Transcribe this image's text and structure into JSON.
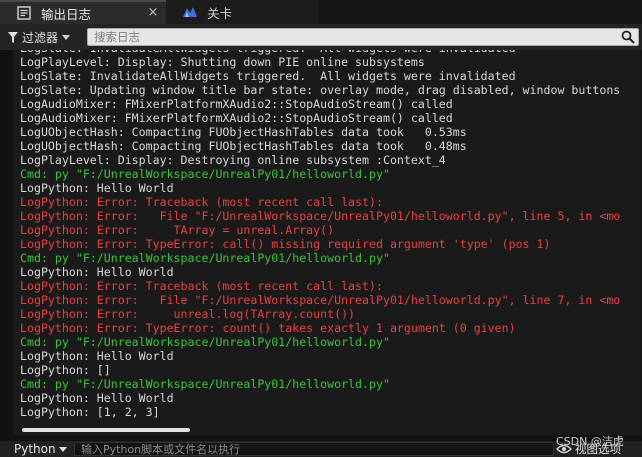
{
  "tabs": [
    {
      "label": "输出日志",
      "icon": "output-log-icon",
      "active": true
    },
    {
      "label": "关卡",
      "icon": "unreal-level-icon",
      "active": false
    }
  ],
  "tab_close": "×",
  "filter": {
    "label": "过滤器",
    "search_placeholder": "搜索日志"
  },
  "log_lines": [
    {
      "text": "LogSlate: InvalidateAllWidgets triggered.  All widgets were invalidated",
      "kind": "normal"
    },
    {
      "text": "LogPlayLevel: Display: Shutting down PIE online subsystems",
      "kind": "normal"
    },
    {
      "text": "LogSlate: InvalidateAllWidgets triggered.  All widgets were invalidated",
      "kind": "normal"
    },
    {
      "text": "LogSlate: Updating window title bar state: overlay mode, drag disabled, window buttons",
      "kind": "normal"
    },
    {
      "text": "LogAudioMixer: FMixerPlatformXAudio2::StopAudioStream() called",
      "kind": "normal"
    },
    {
      "text": "LogAudioMixer: FMixerPlatformXAudio2::StopAudioStream() called",
      "kind": "normal"
    },
    {
      "text": "LogUObjectHash: Compacting FUObjectHashTables data took   0.53ms",
      "kind": "normal"
    },
    {
      "text": "LogUObjectHash: Compacting FUObjectHashTables data took   0.48ms",
      "kind": "normal"
    },
    {
      "text": "LogPlayLevel: Display: Destroying online subsystem :Context_4",
      "kind": "normal"
    },
    {
      "text": "Cmd: py \"F:/UnrealWorkspace/UnrealPy01/helloworld.py\"",
      "kind": "cmd"
    },
    {
      "text": "LogPython: Hello World",
      "kind": "normal"
    },
    {
      "text": "LogPython: Error: Traceback (most recent call last):",
      "kind": "error"
    },
    {
      "text": "LogPython: Error:   File \"F:/UnrealWorkspace/UnrealPy01/helloworld.py\", line 5, in <mo",
      "kind": "error"
    },
    {
      "text": "LogPython: Error:     TArray = unreal.Array()",
      "kind": "error"
    },
    {
      "text": "LogPython: Error: TypeError: call() missing required argument 'type' (pos 1)",
      "kind": "error"
    },
    {
      "text": "Cmd: py \"F:/UnrealWorkspace/UnrealPy01/helloworld.py\"",
      "kind": "cmd"
    },
    {
      "text": "LogPython: Hello World",
      "kind": "normal"
    },
    {
      "text": "LogPython: Error: Traceback (most recent call last):",
      "kind": "error"
    },
    {
      "text": "LogPython: Error:   File \"F:/UnrealWorkspace/UnrealPy01/helloworld.py\", line 7, in <mo",
      "kind": "error"
    },
    {
      "text": "LogPython: Error:     unreal.log(TArray.count())",
      "kind": "error"
    },
    {
      "text": "LogPython: Error: TypeError: count() takes exactly 1 argument (0 given)",
      "kind": "error"
    },
    {
      "text": "Cmd: py \"F:/UnrealWorkspace/UnrealPy01/helloworld.py\"",
      "kind": "cmd"
    },
    {
      "text": "LogPython: Hello World",
      "kind": "normal"
    },
    {
      "text": "LogPython: []",
      "kind": "normal"
    },
    {
      "text": "Cmd: py \"F:/UnrealWorkspace/UnrealPy01/helloworld.py\"",
      "kind": "cmd"
    },
    {
      "text": "LogPython: Hello World",
      "kind": "normal"
    },
    {
      "text": "LogPython: [1, 2, 3]",
      "kind": "normal"
    }
  ],
  "bottom": {
    "cmd_mode": "Python",
    "cmd_placeholder": "输入Python脚本或文件名以执行",
    "view_options": "视图选项"
  },
  "watermark": "CSDN @洁虎",
  "colors": {
    "normal": "#d8d8d8",
    "cmd": "#3bc43b",
    "error": "#e84040"
  }
}
